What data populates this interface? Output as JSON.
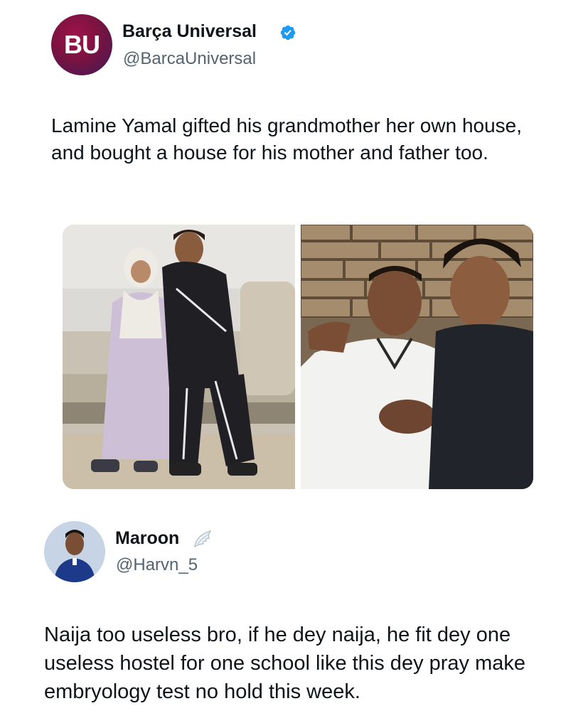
{
  "post1": {
    "display_name": "Barça Universal",
    "handle": "@BarcaUniversal",
    "avatar_letters": "BU",
    "verified": true,
    "verified_icon": "verified-badge-icon",
    "text": "Lamine Yamal gifted his grandmother her own house, and bought a house for his mother and father too.",
    "media": {
      "count": 2,
      "left_photo": "photo of grandmother and Lamine Yamal sitting on a sofa",
      "right_photo": "photo of father and Lamine Yamal in front of a stone wall"
    }
  },
  "post2": {
    "display_name": "Maroon",
    "handle": "@Harvn_5",
    "badge_icon": "angel-wing-icon",
    "text": "Naija too useless bro, if he dey naija, he fit dey one useless hostel for one school like this dey pray make embryology test no hold this week."
  },
  "colors": {
    "text_primary": "#0f1419",
    "text_secondary": "#536471",
    "verified_blue": "#1d9bf0"
  }
}
